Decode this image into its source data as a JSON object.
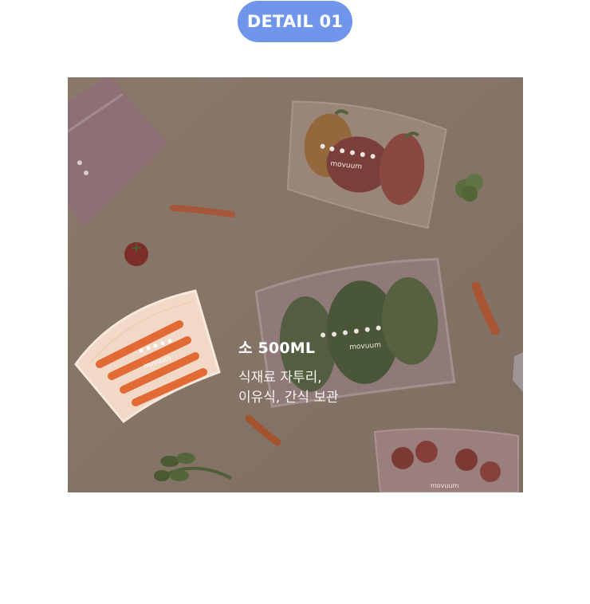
{
  "badge": {
    "label": "DETAIL 01",
    "color": "#6f96ea"
  },
  "photo": {
    "brand_mark": "movuum",
    "caption": {
      "title": "소 500ML",
      "lines": [
        "식재료 자투리,",
        "이유식, 간식 보관"
      ]
    }
  }
}
